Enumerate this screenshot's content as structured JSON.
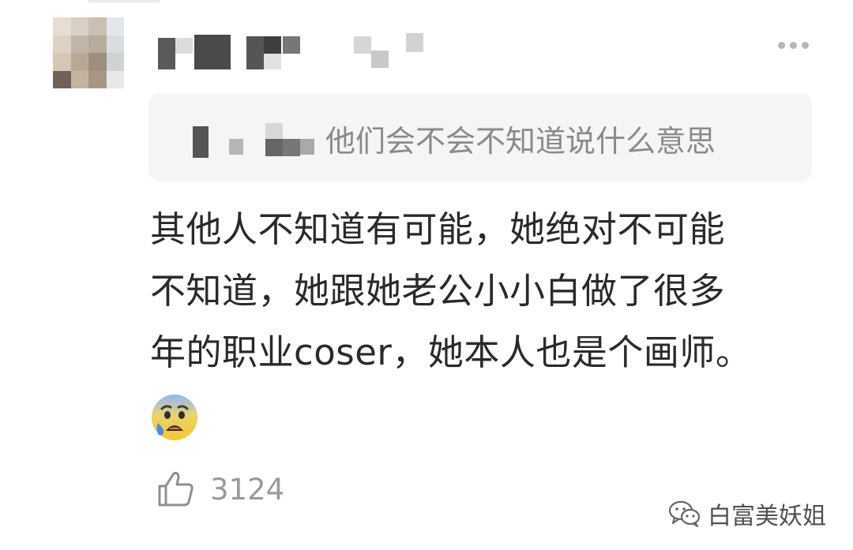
{
  "comment": {
    "more_menu_icon": "more-dots-icon",
    "reply_quote": {
      "text": "他们会不会不知道说什么意思"
    },
    "body_lines": [
      "其他人不知道有可能，她绝对不可能",
      "不知道，她跟她老公小小白做了很多",
      "年的职业coser，她本人也是个画师。"
    ],
    "emoji": "anxious-face-with-sweat",
    "likes": {
      "icon": "thumbs-up-icon",
      "count": "3124"
    }
  },
  "watermark": {
    "icon": "wechat-icon",
    "text": "白富美妖姐"
  },
  "colors": {
    "background": "#ffffff",
    "quote_background": "#f5f5f5",
    "body_text": "#2a2a2a",
    "secondary_text": "#8a8a8a",
    "icon_gray": "#9a9a9a"
  }
}
